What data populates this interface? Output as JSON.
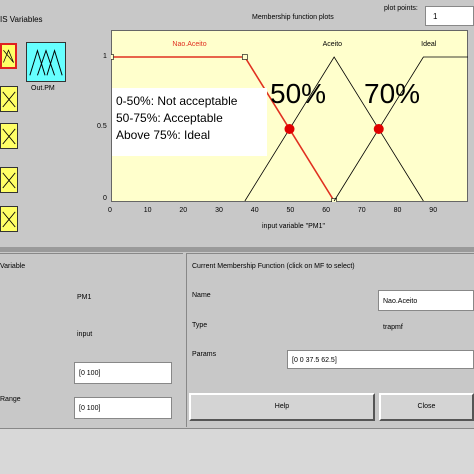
{
  "header": {
    "fis_variables_label": "IS Variables",
    "plot_title": "Membership function plots",
    "plot_points_label": "plot points:",
    "plot_points_value": "1"
  },
  "output_variable": {
    "label": "Out.PM",
    "icon": "three-triangles-mf-icon"
  },
  "input_icons": [
    "mf-icon",
    "mf-icon",
    "mf-icon",
    "mf-icon",
    "mf-icon"
  ],
  "plot": {
    "mf_labels": [
      "Nao.Aceito",
      "Aceito",
      "Ideal"
    ],
    "y_ticks": [
      "1",
      "0.5",
      "0"
    ],
    "x_ticks": [
      "0",
      "10",
      "20",
      "30",
      "40",
      "50",
      "60",
      "70",
      "80",
      "90"
    ],
    "x_label": "input variable \"PM1\"",
    "annotation_lines": [
      "0-50%: Not acceptable",
      "50-75%: Acceptable",
      "Above 75%: Ideal"
    ],
    "highlight_labels": [
      "50%",
      "70%"
    ],
    "colors": {
      "background": "#ffffcc",
      "selected_mf": "#e03020",
      "other_mf": "#000000",
      "marker": "#e00000"
    }
  },
  "chart_data": {
    "type": "line",
    "xlabel": "input variable \"PM1\"",
    "xlim": [
      0,
      100
    ],
    "ylim": [
      0,
      1
    ],
    "series": [
      {
        "name": "Nao.Aceito",
        "x": [
          0,
          37.5,
          62.5
        ],
        "values": [
          1,
          1,
          0
        ]
      },
      {
        "name": "Aceito",
        "x": [
          37.5,
          62.5,
          87.5
        ],
        "values": [
          0,
          1,
          0
        ]
      },
      {
        "name": "Ideal",
        "x": [
          62.5,
          87.5,
          100
        ],
        "values": [
          0,
          1,
          1
        ]
      }
    ],
    "markers": [
      {
        "x": 50,
        "y": 0.5
      },
      {
        "x": 75,
        "y": 0.5
      }
    ]
  },
  "variable_panel": {
    "title": "Variable",
    "name": "PM1",
    "type": "input",
    "range": "[0 100]",
    "display_range_label": "Range",
    "display_range": "[0 100]"
  },
  "mf_panel": {
    "title": "Current Membership Function (click on MF to select)",
    "name_label": "Name",
    "name_value": "Nao.Aceito",
    "type_label": "Type",
    "type_value": "trapmf",
    "params_label": "Params",
    "params_value": "[0 0 37.5 62.5]",
    "help_label": "Help",
    "close_label": "Close"
  }
}
